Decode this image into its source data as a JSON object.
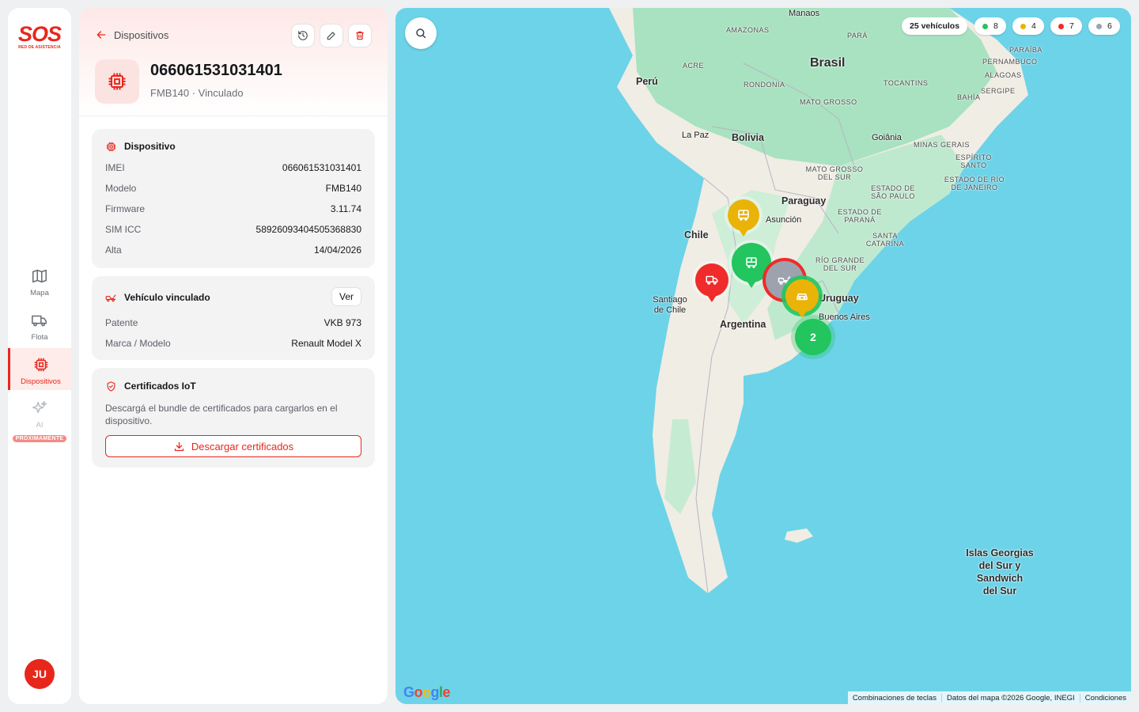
{
  "brand": {
    "name": "SOS",
    "tagline": "RED DE ASISTENCIA",
    "color": "#e8271c"
  },
  "nav": {
    "items": [
      {
        "label": "Mapa",
        "icon": "map-icon"
      },
      {
        "label": "Flota",
        "icon": "truck-icon"
      },
      {
        "label": "Dispositivos",
        "icon": "chip-icon",
        "active": true
      },
      {
        "label": "AI",
        "icon": "sparkles-icon",
        "badge": "PRÓXIMAMENTE"
      }
    ],
    "user_initials": "JU"
  },
  "panel": {
    "back_label": "Dispositivos",
    "actions": [
      "history-icon",
      "edit-icon",
      "trash-icon"
    ],
    "title": "066061531031401",
    "subtitle": "FMB140 · Vinculado",
    "device_card": {
      "title": "Dispositivo",
      "rows": [
        {
          "key": "IMEI",
          "value": "066061531031401"
        },
        {
          "key": "Modelo",
          "value": "FMB140"
        },
        {
          "key": "Firmware",
          "value": "3.11.74"
        },
        {
          "key": "SIM ICC",
          "value": "58926093404505368830"
        },
        {
          "key": "Alta",
          "value": "14/04/2026"
        }
      ]
    },
    "vehicle_card": {
      "title": "Vehículo vinculado",
      "action_label": "Ver",
      "rows": [
        {
          "key": "Patente",
          "value": "VKB 973"
        },
        {
          "key": "Marca / Modelo",
          "value": "Renault Model X"
        }
      ]
    },
    "cert_card": {
      "title": "Certificados IoT",
      "description": "Descargá el bundle de certificados para cargarlos en el dispositivo.",
      "button_label": "Descargar certificados"
    }
  },
  "map": {
    "legend": {
      "total": "25 vehículos",
      "statuses": [
        {
          "count": "8",
          "color": "#22c55e"
        },
        {
          "count": "4",
          "color": "#eab308"
        },
        {
          "count": "7",
          "color": "#ef2b2b"
        },
        {
          "count": "6",
          "color": "#9ca3af"
        }
      ]
    },
    "countries": [
      "Brasil",
      "Perú",
      "Bolivia",
      "Paraguay",
      "Chile",
      "Argentina",
      "Uruguay"
    ],
    "cities": [
      "Manaos",
      "La Paz",
      "Goiânia",
      "Asunción",
      "Santiago de Chile",
      "Buenos Aires"
    ],
    "regions": [
      "AMAZONAS",
      "PARÁ",
      "PARAÍBA",
      "PERNAMBUCO",
      "ALAGOAS",
      "SERGIPE",
      "BAHÍA",
      "TOCANTINS",
      "ACRE",
      "RONDONIA",
      "MATO GROSSO",
      "MINAS GERAIS",
      "ESPÍRITO SANTO",
      "MATO GROSSO DEL SUR",
      "ESTADO DE SÃO PAULO",
      "ESTADO DE RÍO DE JANEIRO",
      "ESTADO DE PARANÁ",
      "SANTA CATARINA",
      "RÍO GRANDE DEL SUR"
    ],
    "islands": "Islands Georgias del Sur y Sandwich del Sur",
    "islands_lines": [
      "Islas Georgias",
      "del Sur y",
      "Sandwich",
      "del Sur"
    ],
    "cluster_count": "2",
    "markers": [
      {
        "status": "yellow",
        "icon": "bus-icon"
      },
      {
        "status": "green",
        "icon": "bus-icon"
      },
      {
        "status": "red",
        "icon": "truck-icon"
      },
      {
        "status": "gray",
        "icon": "tow-truck-icon"
      },
      {
        "status": "yellow",
        "icon": "car-icon"
      }
    ],
    "attribution": [
      "Combinaciones de teclas",
      "Datos del mapa ©2026 Google, INEGI",
      "Condiciones"
    ],
    "google_logo": "Google"
  }
}
